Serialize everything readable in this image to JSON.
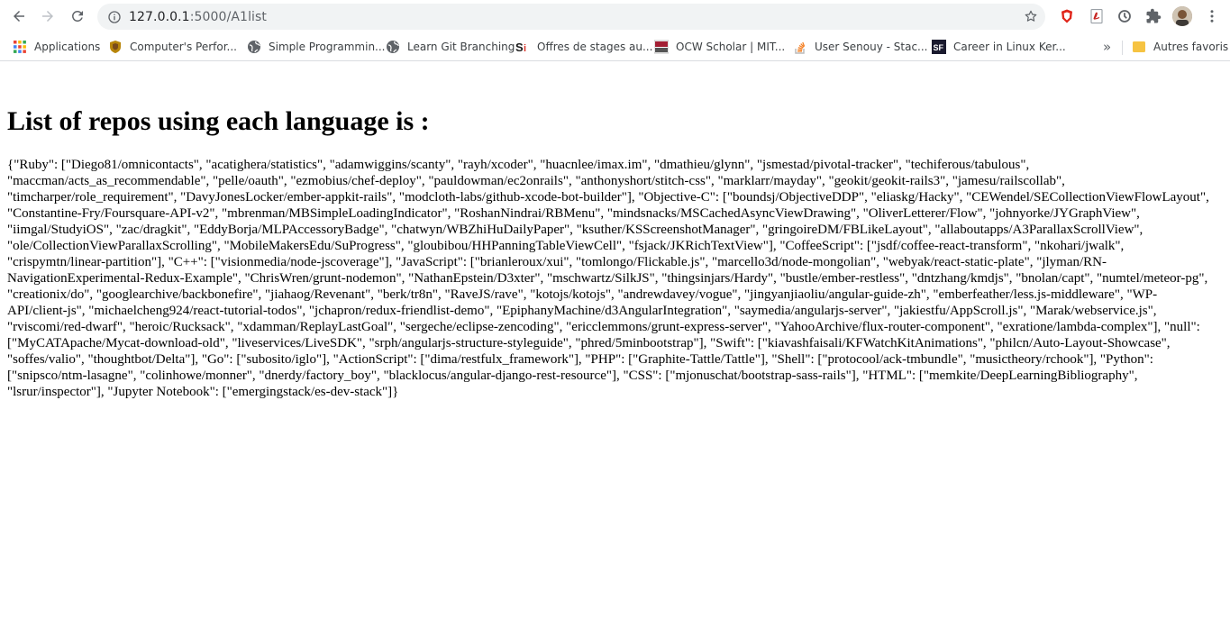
{
  "browser": {
    "url_host": "127.0.0.1",
    "url_port": ":5000",
    "url_path": "/A1list"
  },
  "bookmarks": [
    {
      "label": "Applications",
      "icon": "apps-grid-icon"
    },
    {
      "label": "Computer's Perfor...",
      "icon": "shield-crest-icon"
    },
    {
      "label": "Simple Programmin...",
      "icon": "globe-icon"
    },
    {
      "label": "Learn Git Branching",
      "icon": "globe-icon"
    },
    {
      "label": "Offres de stages au...",
      "icon": "si-logo-icon"
    },
    {
      "label": "OCW Scholar | MIT...",
      "icon": "mit-logo-icon"
    },
    {
      "label": "User Senouy - Stac...",
      "icon": "stackoverflow-icon"
    },
    {
      "label": "Career in Linux Ker...",
      "icon": "sf-logo-icon"
    }
  ],
  "bookmarks_overflow": "»",
  "other_bookmarks": "Autres favoris",
  "page": {
    "heading": "List of repos using each language is :",
    "body": "{\"Ruby\": [\"Diego81/omnicontacts\", \"acatighera/statistics\", \"adamwiggins/scanty\", \"rayh/xcoder\", \"huacnlee/imax.im\", \"dmathieu/glynn\", \"jsmestad/pivotal-tracker\", \"techiferous/tabulous\", \"maccman/acts_as_recommendable\", \"pelle/oauth\", \"ezmobius/chef-deploy\", \"pauldowman/ec2onrails\", \"anthonyshort/stitch-css\", \"marklarr/mayday\", \"geokit/geokit-rails3\", \"jamesu/railscollab\", \"timcharper/role_requirement\", \"DavyJonesLocker/ember-appkit-rails\", \"modcloth-labs/github-xcode-bot-builder\"], \"Objective-C\": [\"boundsj/ObjectiveDDP\", \"eliaskg/Hacky\", \"CEWendel/SECollectionViewFlowLayout\", \"Constantine-Fry/Foursquare-API-v2\", \"mbrenman/MBSimpleLoadingIndicator\", \"RoshanNindrai/RBMenu\", \"mindsnacks/MSCachedAsyncViewDrawing\", \"OliverLetterer/Flow\", \"johnyorke/JYGraphView\", \"iimgal/StudyiOS\", \"zac/dragkit\", \"EddyBorja/MLPAccessoryBadge\", \"chatwyn/WBZhiHuDailyPaper\", \"ksuther/KSScreenshotManager\", \"gringoireDM/FBLikeLayout\", \"allaboutapps/A3ParallaxScrollView\", \"ole/CollectionViewParallaxScrolling\", \"MobileMakersEdu/SuProgress\", \"gloubibou/HHPanningTableViewCell\", \"fsjack/JKRichTextView\"], \"CoffeeScript\": [\"jsdf/coffee-react-transform\", \"nkohari/jwalk\", \"crispymtn/linear-partition\"], \"C++\": [\"visionmedia/node-jscoverage\"], \"JavaScript\": [\"brianleroux/xui\", \"tomlongo/Flickable.js\", \"marcello3d/node-mongolian\", \"webyak/react-static-plate\", \"jlyman/RN-NavigationExperimental-Redux-Example\", \"ChrisWren/grunt-nodemon\", \"NathanEpstein/D3xter\", \"mschwartz/SilkJS\", \"thingsinjars/Hardy\", \"bustle/ember-restless\", \"dntzhang/kmdjs\", \"bnolan/capt\", \"numtel/meteor-pg\", \"creationix/do\", \"googlearchive/backbonefire\", \"jiahaog/Revenant\", \"berk/tr8n\", \"RaveJS/rave\", \"kotojs/kotojs\", \"andrewdavey/vogue\", \"jingyanjiaoliu/angular-guide-zh\", \"emberfeather/less.js-middleware\", \"WP-API/client-js\", \"michaelcheng924/react-tutorial-todos\", \"jchapron/redux-friendlist-demo\", \"EpiphanyMachine/d3AngularIntegration\", \"saymedia/angularjs-server\", \"jakiestfu/AppScroll.js\", \"Marak/webservice.js\", \"rviscomi/red-dwarf\", \"heroic/Rucksack\", \"xdamman/ReplayLastGoal\", \"sergeche/eclipse-zencoding\", \"ericclemmons/grunt-express-server\", \"YahooArchive/flux-router-component\", \"exratione/lambda-complex\"], \"null\": [\"MyCATApache/Mycat-download-old\", \"liveservices/LiveSDK\", \"srph/angularjs-structure-styleguide\", \"phred/5minbootstrap\"], \"Swift\": [\"kiavashfaisali/KFWatchKitAnimations\", \"philcn/Auto-Layout-Showcase\", \"soffes/valio\", \"thoughtbot/Delta\"], \"Go\": [\"subosito/iglo\"], \"ActionScript\": [\"dima/restfulx_framework\"], \"PHP\": [\"Graphite-Tattle/Tattle\"], \"Shell\": [\"protocool/ack-tmbundle\", \"musictheory/rchook\"], \"Python\": [\"snipsco/ntm-lasagne\", \"colinhowe/monner\", \"dnerdy/factory_boy\", \"blacklocus/angular-django-rest-resource\"], \"CSS\": [\"mjonuschat/bootstrap-sass-rails\"], \"HTML\": [\"memkite/DeepLearningBibliography\", \"lsrur/inspector\"], \"Jupyter Notebook\": [\"emergingstack/es-dev-stack\"]}"
  },
  "colors": {
    "toolbar_icon": "#5f6368",
    "omnibox_bg": "#f1f3f4",
    "brave_red": "#e0261b",
    "folder_yellow": "#f6c342"
  }
}
